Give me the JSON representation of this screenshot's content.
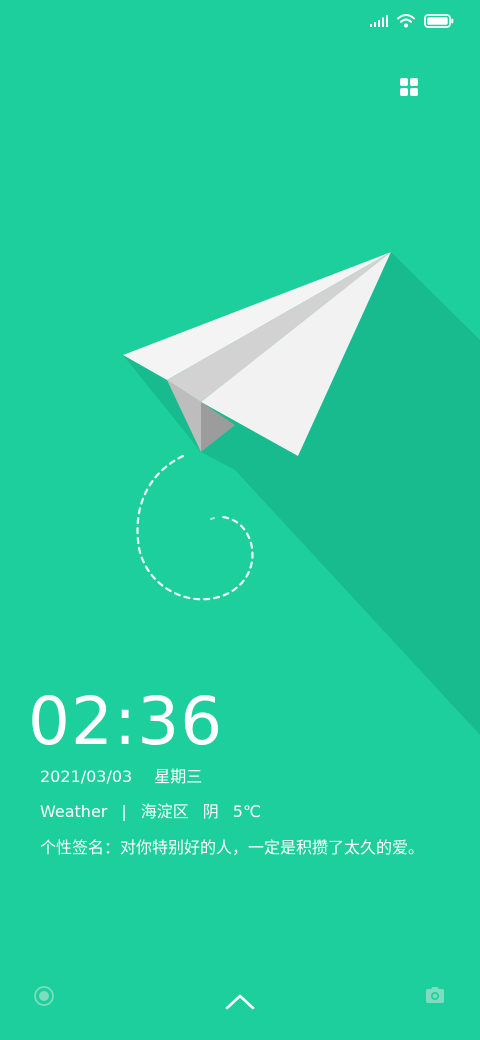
{
  "status_bar": {
    "icons": [
      "signal-icon",
      "wifi-icon",
      "battery-icon"
    ],
    "battery_level": 1.0
  },
  "lockscreen": {
    "time": "02:36",
    "date": "2021/03/03",
    "weekday": "星期三",
    "weather": {
      "label": "Weather",
      "separator": "|",
      "district": "海淀区",
      "condition": "阴",
      "temperature": "5℃"
    },
    "signature": "个性签名：对你特别好的人，一定是积攒了太久的爱。"
  },
  "wallpaper": {
    "subject": "paper-plane",
    "background_color": "#1ccf9c",
    "shadow_color": "#18bb8d"
  },
  "bottom_bar": {
    "left_icon": "record-icon",
    "center_icon": "chevron-up-icon",
    "right_icon": "camera-icon"
  }
}
